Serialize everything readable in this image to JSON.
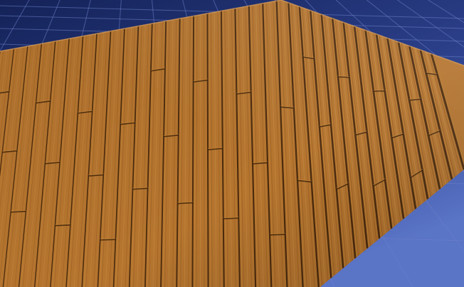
{
  "scene": {
    "background_top_color": "#142257",
    "background_bottom_color": "#5a74c6",
    "grid_line_color": "#6d82c8",
    "wood_light_color": "#c98839",
    "wood_mid_color": "#9d5f1f",
    "wood_dark_color": "#3a1f07",
    "ground_grid_visible": true,
    "floor_material": "wood-planks"
  }
}
